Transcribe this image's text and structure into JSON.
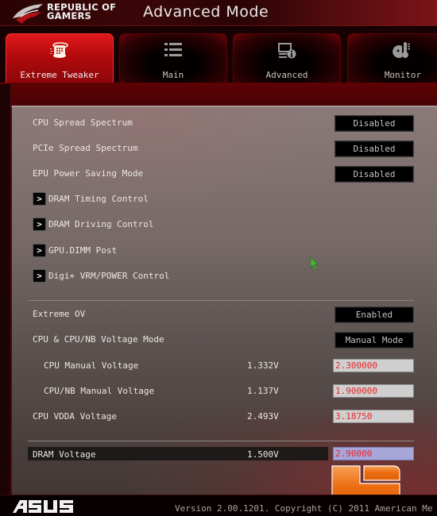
{
  "header": {
    "brand_line1": "REPUBLIC OF",
    "brand_line2": "GAMERS",
    "title": "Advanced Mode"
  },
  "tabs": [
    {
      "label": "Extreme Tweaker",
      "icon": "extreme-tweaker-icon",
      "active": true
    },
    {
      "label": "Main",
      "icon": "list-icon",
      "active": false
    },
    {
      "label": "Advanced",
      "icon": "advanced-info-icon",
      "active": false
    },
    {
      "label": "Monitor",
      "icon": "monitor-thermometer-icon",
      "active": false
    }
  ],
  "settings": {
    "cpu_spread_spectrum": {
      "label": "CPU Spread Spectrum",
      "value": "Disabled"
    },
    "pcie_spread_spectrum": {
      "label": "PCIe Spread Spectrum",
      "value": "Disabled"
    },
    "epu_power_saving": {
      "label": "EPU Power Saving Mode",
      "value": "Disabled"
    },
    "submenus": [
      {
        "label": "DRAM Timing Control"
      },
      {
        "label": "DRAM Driving Control"
      },
      {
        "label": "GPU.DIMM Post"
      },
      {
        "label": "Digi+ VRM/POWER Control"
      }
    ],
    "extreme_ov": {
      "label": "Extreme OV",
      "value": "Enabled"
    },
    "voltage_mode": {
      "label": "CPU & CPU/NB Voltage Mode",
      "value": "Manual Mode"
    },
    "cpu_manual_voltage": {
      "label": "CPU Manual Voltage",
      "reading": "1.332V",
      "value": "2.300000"
    },
    "cpunb_manual_voltage": {
      "label": "CPU/NB Manual Voltage",
      "reading": "1.137V",
      "value": "1.900000"
    },
    "cpu_vdda_voltage": {
      "label": "CPU VDDA Voltage",
      "reading": "2.493V",
      "value": "3.18750"
    },
    "dram_voltage": {
      "label": "DRAM Voltage",
      "reading": "1.500V",
      "value": "2.90000"
    }
  },
  "submenu_arrow": ">",
  "footer": {
    "brand": "ASUS",
    "version": "Version 2.00.1201. Copyright (C) 2011 American Me"
  },
  "colors": {
    "accent_red": "#d4161a",
    "value_text_red": "#e8262b",
    "selected_input": "#a7a6d8",
    "watermark_orange": "#e8680f"
  }
}
